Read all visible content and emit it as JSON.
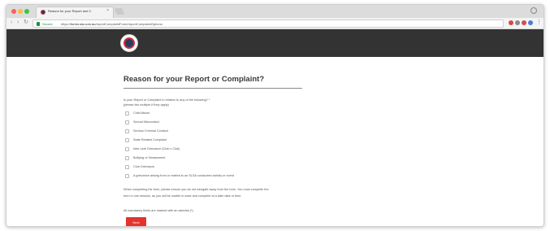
{
  "browser": {
    "tab_title": "Reason for your Report and C",
    "tab_close": "×",
    "menu_glyph": "⋮",
    "secure_label": "Secure",
    "url_scheme": "https://",
    "url_host": "forms.sla.com.au",
    "url_path": "/reportComplaintForm/reportComplaintOptions"
  },
  "form": {
    "title": "Reason for your Report or Complaint?",
    "question_line1": "Is your Report or Complaint in relation to any of the following? *",
    "question_line2": "(please tick multiple if they apply)",
    "options": [
      "Child Abuse",
      "Sexual Misconduct",
      "Serious Criminal Conduct",
      "State Related Complaint",
      "Inter-club Grievance (Club v Club)",
      "Bullying or Harassment",
      "Club Grievance",
      "A grievance arising from or related to an SLSA conducted activity or event"
    ],
    "notice_line1": "When completing the form, please ensure you do not navigate away from the form. You must complete the",
    "notice_line2": "form in one session, as you will be unable to save and complete at a later date or time.",
    "mandatory_note": "All mandatory fields are marked with an asterisk (*).",
    "next_label": "Next"
  },
  "colors": {
    "header_bg": "#333333",
    "accent_red": "#e5322d",
    "secure_green": "#1e8e3e"
  }
}
